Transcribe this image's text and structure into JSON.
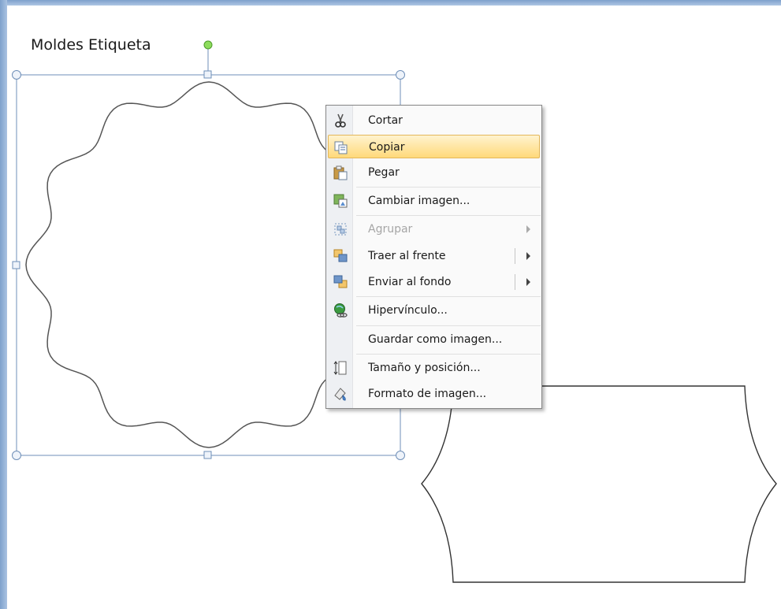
{
  "document": {
    "title": "Moldes Etiqueta"
  },
  "context_menu": {
    "items": [
      {
        "label": "Cortar",
        "icon": "scissors-icon"
      },
      {
        "label": "Copiar",
        "icon": "copy-icon",
        "highlighted": true
      },
      {
        "label": "Pegar",
        "icon": "paste-icon"
      },
      {
        "label": "Cambiar imagen...",
        "icon": "change-picture-icon"
      },
      {
        "label": "Agrupar",
        "icon": "group-icon",
        "disabled": true,
        "submenu": true
      },
      {
        "label": "Traer al frente",
        "icon": "bring-to-front-icon",
        "submenu": true
      },
      {
        "label": "Enviar al fondo",
        "icon": "send-to-back-icon",
        "submenu": true
      },
      {
        "label": "Hipervínculo...",
        "icon": "hyperlink-icon"
      },
      {
        "label": "Guardar como imagen..."
      },
      {
        "label": "Tamaño y posición...",
        "icon": "size-position-icon"
      },
      {
        "label": "Formato de imagen...",
        "icon": "format-picture-icon"
      }
    ]
  },
  "colors": {
    "highlight_top": "#fff3cf",
    "highlight_bottom": "#ffd97a",
    "selection_handle": "#6f8fb8",
    "rotation_handle": "#5fc33a"
  }
}
